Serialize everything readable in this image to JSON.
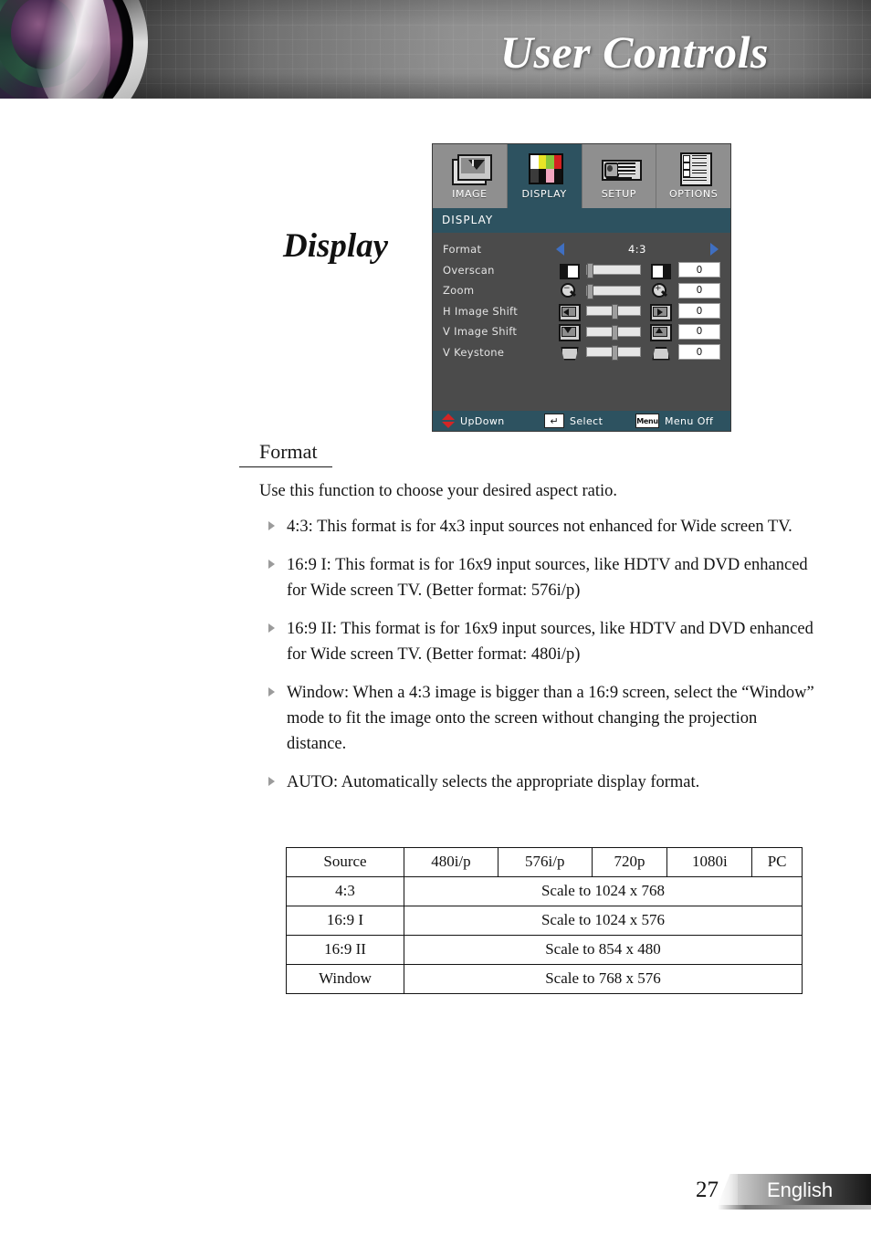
{
  "header": {
    "title": "User Controls",
    "lens_icon": "camera-lens-icon"
  },
  "page_section_title": "Display",
  "osd": {
    "tabs": [
      {
        "label": "IMAGE",
        "icon": "image-stack-icon",
        "active": false
      },
      {
        "label": "DISPLAY",
        "icon": "color-bars-icon",
        "active": true
      },
      {
        "label": "SETUP",
        "icon": "projector-icon",
        "active": false
      },
      {
        "label": "OPTIONS",
        "icon": "checklist-icon",
        "active": false
      }
    ],
    "menu_title": "DISPLAY",
    "rows": [
      {
        "label": "Format",
        "type": "selector",
        "value": "4:3"
      },
      {
        "label": "Overscan",
        "type": "slider",
        "value": "0",
        "handle_pct": 0,
        "icon_left": "overscan-narrow-icon",
        "icon_right": "overscan-wide-icon"
      },
      {
        "label": "Zoom",
        "type": "slider",
        "value": "0",
        "handle_pct": 0,
        "icon_left": "zoom-out-icon",
        "icon_right": "zoom-in-icon"
      },
      {
        "label": "H Image Shift",
        "type": "slider",
        "value": "0",
        "handle_pct": 50,
        "icon_left": "shift-left-icon",
        "icon_right": "shift-right-icon"
      },
      {
        "label": "V Image Shift",
        "type": "slider",
        "value": "0",
        "handle_pct": 50,
        "icon_left": "shift-down-icon",
        "icon_right": "shift-up-icon"
      },
      {
        "label": "V Keystone",
        "type": "slider",
        "value": "0",
        "handle_pct": 50,
        "icon_left": "keystone-narrow-top-icon",
        "icon_right": "keystone-wide-top-icon"
      }
    ],
    "footer": [
      {
        "icon": "up-down-arrows-icon",
        "label": "UpDown"
      },
      {
        "icon": "enter-key-icon",
        "glyph": "↵",
        "label": "Select"
      },
      {
        "icon": "menu-key-icon",
        "glyph": "Menu",
        "label": "Menu Off"
      }
    ],
    "colors": {
      "title_bar": "#2d5260",
      "body": "#4b4b4b",
      "tab_bar": "#8f8f8f",
      "arrow": "#3f6fc1",
      "updown_arrow": "#d42525"
    }
  },
  "section": {
    "heading": "Format",
    "intro": "Use this function to choose your desired aspect ratio.",
    "bullets": [
      "4:3: This format is for 4x3 input sources not enhanced for Wide screen TV.",
      "16:9 I: This format is for 16x9 input sources, like HDTV and DVD enhanced for Wide screen TV. (Better format: 576i/p)",
      "16:9 II: This format is for 16x9 input sources, like HDTV and DVD enhanced for Wide screen TV. (Better format: 480i/p)",
      "Window: When a 4:3 image is bigger than a 16:9 screen, select the “Window” mode to fit the image onto the screen without changing the projection distance.",
      "AUTO: Automatically selects the appropriate display format."
    ]
  },
  "table": {
    "headers": [
      "Source",
      "480i/p",
      "576i/p",
      "720p",
      "1080i",
      "PC"
    ],
    "rows": [
      {
        "source": "4:3",
        "scale": "Scale to 1024 x 768"
      },
      {
        "source": "16:9 I",
        "scale": "Scale to 1024 x 576"
      },
      {
        "source": "16:9 II",
        "scale": "Scale to   854 x 480"
      },
      {
        "source": "Window",
        "scale": "Scale to   768 x 576"
      }
    ]
  },
  "footer": {
    "page_number": "27",
    "language": "English"
  }
}
